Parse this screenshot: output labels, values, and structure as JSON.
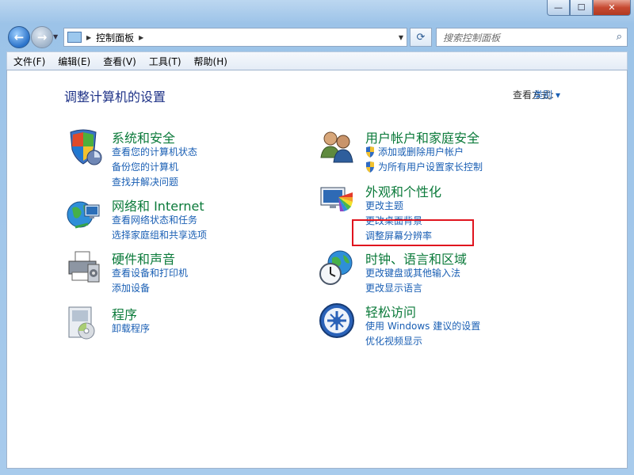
{
  "window": {
    "caption": {
      "minimize": "—",
      "maximize": "☐",
      "close": "✕"
    }
  },
  "nav": {
    "address_text": "控制面板",
    "search_placeholder": "搜索控制面板"
  },
  "menu": [
    "文件(F)",
    "编辑(E)",
    "查看(V)",
    "工具(T)",
    "帮助(H)"
  ],
  "page": {
    "title": "调整计算机的设置",
    "view_by_label": "查看方式:",
    "view_by_value": "类别 ▾"
  },
  "categories": {
    "system": {
      "title": "系统和安全",
      "links": [
        "查看您的计算机状态",
        "备份您的计算机",
        "查找并解决问题"
      ],
      "icon": "shield-icon"
    },
    "network": {
      "title": "网络和 Internet",
      "links": [
        "查看网络状态和任务",
        "选择家庭组和共享选项"
      ],
      "icon": "globe-network-icon"
    },
    "hardware": {
      "title": "硬件和声音",
      "links": [
        "查看设备和打印机",
        "添加设备"
      ],
      "icon": "printer-icon"
    },
    "programs": {
      "title": "程序",
      "links": [
        "卸载程序"
      ],
      "icon": "programs-box-icon"
    },
    "users": {
      "title": "用户帐户和家庭安全",
      "links": [
        "添加或删除用户帐户",
        "为所有用户设置家长控制"
      ],
      "icon": "users-icon"
    },
    "appearance": {
      "title": "外观和个性化",
      "links": [
        "更改主题",
        "更改桌面背景",
        "调整屏幕分辨率"
      ],
      "icon": "monitor-palette-icon"
    },
    "clock": {
      "title": "时钟、语言和区域",
      "links": [
        "更改键盘或其他输入法",
        "更改显示语言"
      ],
      "icon": "clock-globe-icon"
    },
    "ease": {
      "title": "轻松访问",
      "links": [
        "使用 Windows 建议的设置",
        "优化视频显示"
      ],
      "icon": "ease-access-icon"
    }
  },
  "colors": {
    "accent_link": "#1a5fb4",
    "category_title": "#0b7a3a",
    "highlight": "#e0141e"
  }
}
